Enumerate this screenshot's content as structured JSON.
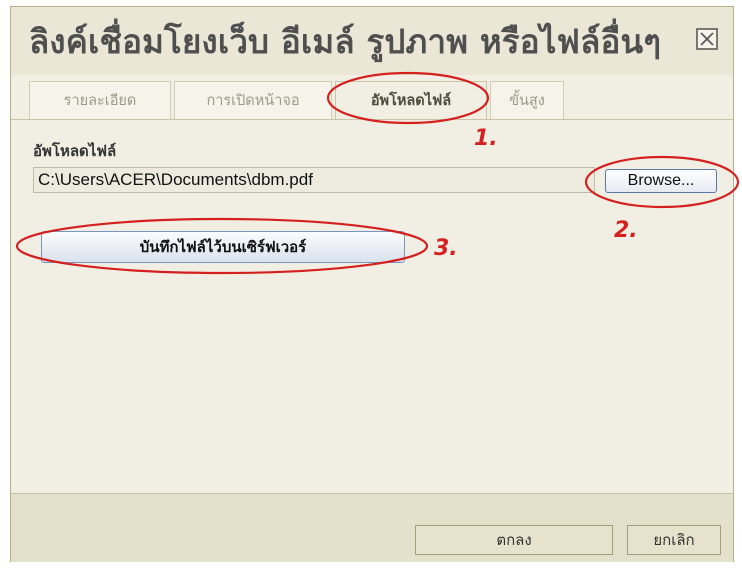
{
  "dialog": {
    "title": "ลิงค์เชื่อมโยงเว็บ อีเมล์ รูปภาพ หรือไฟล์อื่นๆ",
    "close_icon": "close-icon"
  },
  "tabs": [
    {
      "label": "รายละเอียด",
      "active": false
    },
    {
      "label": "การเปิดหน้าจอ",
      "active": false
    },
    {
      "label": "อัพโหลดไฟล์",
      "active": true
    },
    {
      "label": "ขั้นสูง",
      "active": false
    }
  ],
  "upload": {
    "label": "อัพโหลดไฟล์",
    "file_path": "C:\\Users\\ACER\\Documents\\dbm.pdf",
    "browse_label": "Browse...",
    "save_label": "บันทึกไฟล์ไว้บนเซิร์ฟเวอร์"
  },
  "footer": {
    "ok_label": "ตกลง",
    "cancel_label": "ยกเลิก"
  },
  "annotations": {
    "step1": "1.",
    "step2": "2.",
    "step3": "3.",
    "color": "#d52020"
  }
}
